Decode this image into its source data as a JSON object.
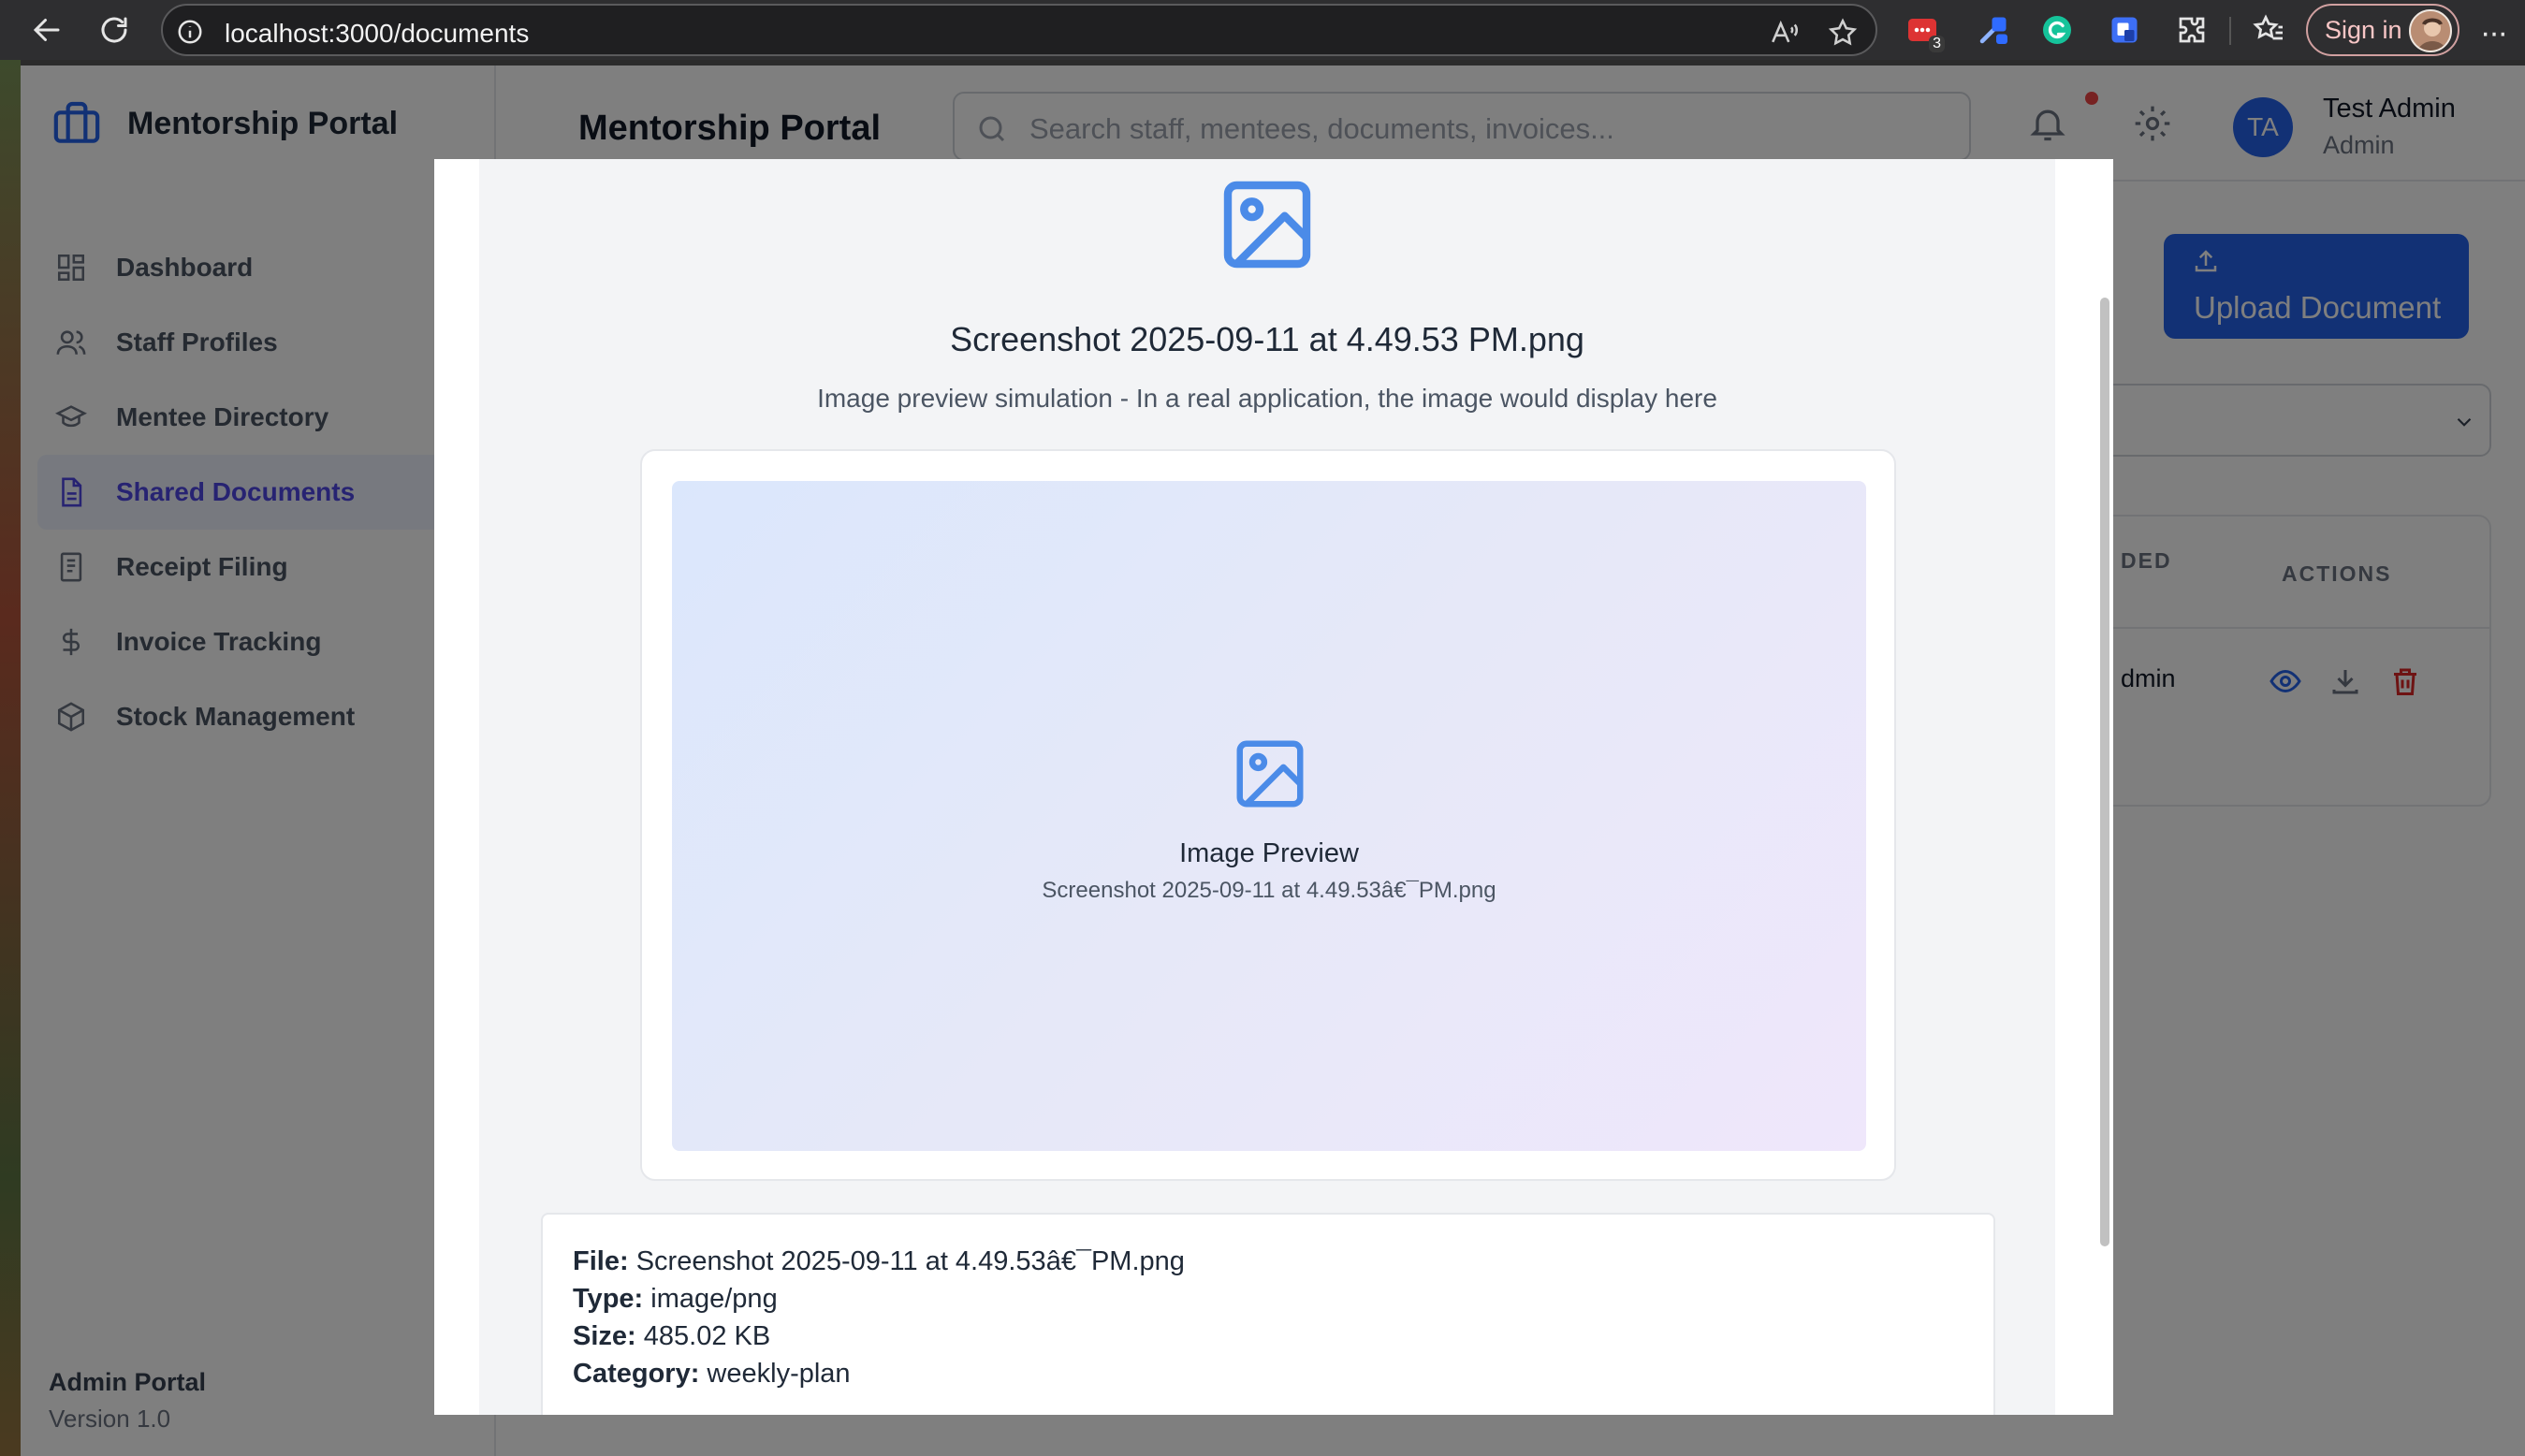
{
  "browser": {
    "url": "localhost:3000/documents",
    "extension_badge": "3",
    "sign_in_label": "Sign in"
  },
  "app": {
    "brand": "Mentorship Portal",
    "page_title": "Mentorship Portal",
    "search_placeholder": "Search staff, mentees, documents, invoices...",
    "user": {
      "initials": "TA",
      "name": "Test Admin",
      "role": "Admin"
    },
    "sidebar": {
      "items": [
        {
          "label": "Dashboard",
          "icon": "grid-icon"
        },
        {
          "label": "Staff Profiles",
          "icon": "users-icon"
        },
        {
          "label": "Mentee Directory",
          "icon": "graduation-cap-icon"
        },
        {
          "label": "Shared Documents",
          "icon": "document-icon",
          "active": true
        },
        {
          "label": "Receipt Filing",
          "icon": "receipt-icon"
        },
        {
          "label": "Invoice Tracking",
          "icon": "dollar-icon"
        },
        {
          "label": "Stock Management",
          "icon": "cube-icon"
        }
      ],
      "footer_title": "Admin Portal",
      "footer_version": "Version 1.0"
    },
    "upload_button": "Upload Document",
    "table": {
      "col_uploaded": "DED",
      "col_actions": "ACTIONS",
      "row_uploader": "dmin"
    }
  },
  "modal": {
    "file_title": "Screenshot 2025-09-11 at 4.49.53 PM.png",
    "simulation_text": "Image preview simulation - In a real application, the image would display here",
    "preview_title": "Image Preview",
    "preview_filename": "Screenshot 2025-09-11 at 4.49.53â€¯PM.png",
    "details": {
      "file_label": "File:",
      "file_value": "Screenshot 2025-09-11 at 4.49.53â€¯PM.png",
      "type_label": "Type:",
      "type_value": "image/png",
      "size_label": "Size:",
      "size_value": "485.02 KB",
      "category_label": "Category:",
      "category_value": "weekly-plan"
    }
  },
  "colors": {
    "accent": "#2563eb",
    "active_nav": "#4f46e5",
    "preview_icon": "#4b8be8",
    "danger": "#dc2626"
  }
}
